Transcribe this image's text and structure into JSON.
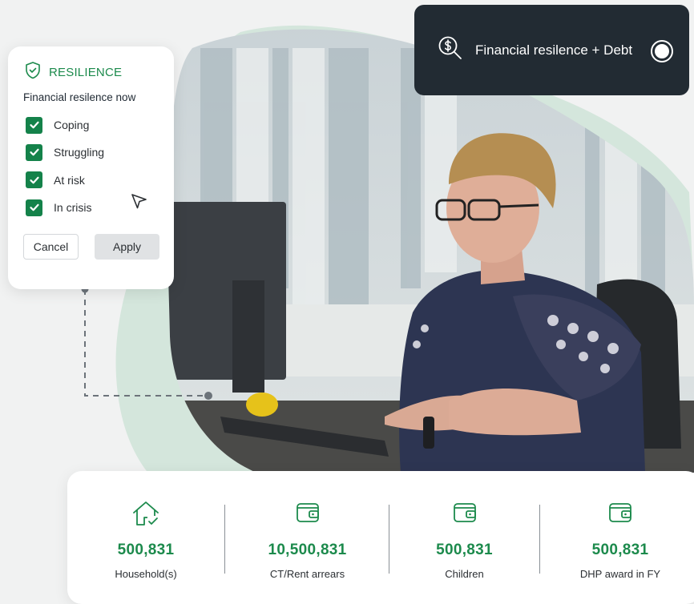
{
  "colors": {
    "brand_green": "#1c8a4c",
    "checkbox_green": "#14824a",
    "dark_card": "#222b33",
    "blob_mint": "#cfe3d9"
  },
  "filter": {
    "title": "RESILIENCE",
    "title_icon": "shield-check-icon",
    "subtitle": "Financial resilence now",
    "options": [
      {
        "label": "Coping",
        "checked": true
      },
      {
        "label": "Struggling",
        "checked": true
      },
      {
        "label": "At risk",
        "checked": true
      },
      {
        "label": "In crisis",
        "checked": true
      }
    ],
    "cancel_label": "Cancel",
    "apply_label": "Apply"
  },
  "debt_card": {
    "icon": "dollar-search-icon",
    "text": "Financial resilence + Debt",
    "toggle_on": true
  },
  "stats": [
    {
      "icon": "house-check-icon",
      "value": "500,831",
      "label": "Household(s)"
    },
    {
      "icon": "wallet-icon",
      "value": "10,500,831",
      "label": "CT/Rent arrears"
    },
    {
      "icon": "wallet-icon",
      "value": "500,831",
      "label": "Children"
    },
    {
      "icon": "wallet-icon",
      "value": "500,831",
      "label": "DHP award in FY"
    }
  ]
}
